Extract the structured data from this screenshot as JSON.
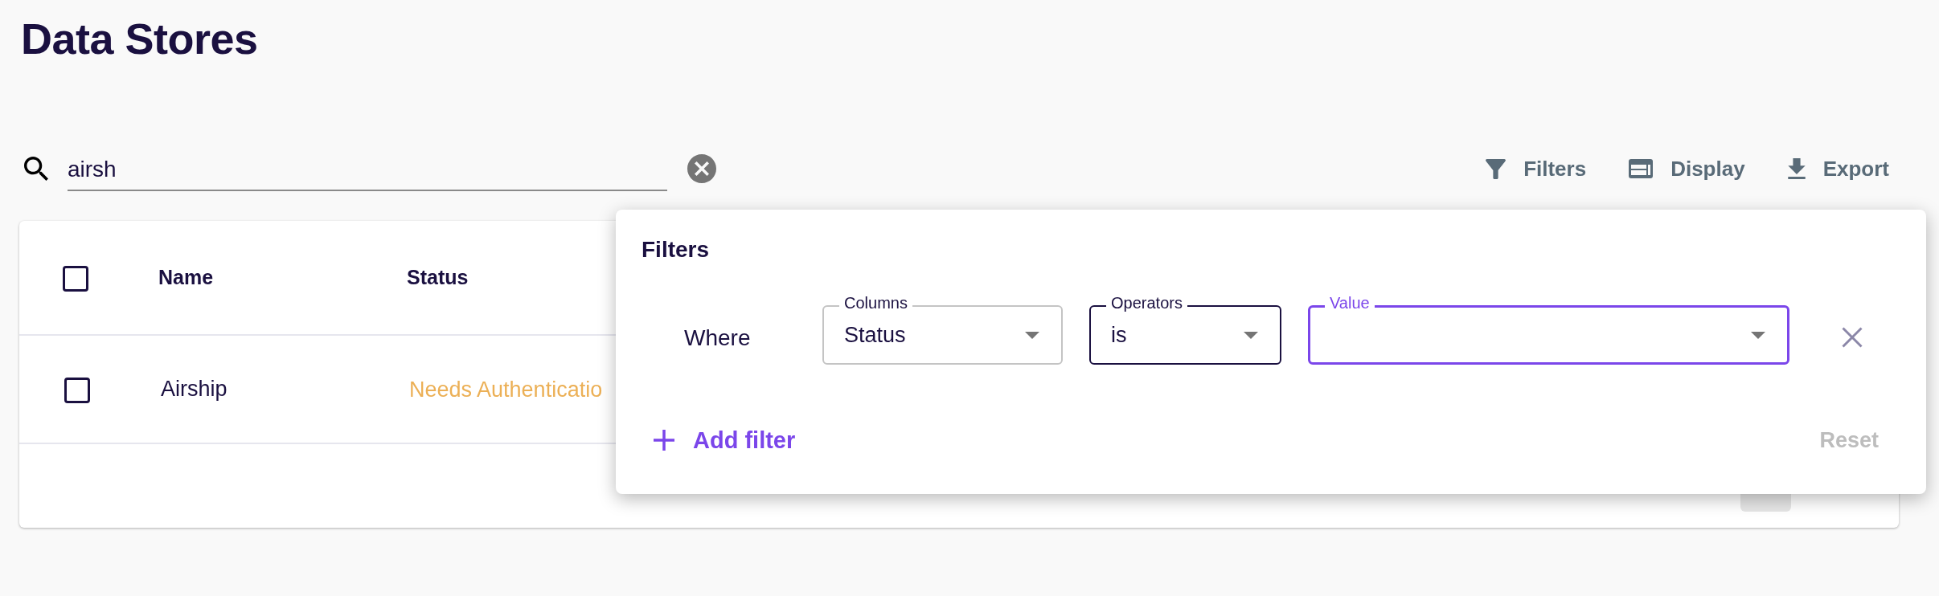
{
  "page": {
    "title": "Data Stores"
  },
  "search": {
    "value": "airsh"
  },
  "toolbar": [
    {
      "kind": "filter",
      "label": "Filters"
    },
    {
      "kind": "display",
      "label": "Display"
    },
    {
      "kind": "export",
      "label": "Export"
    }
  ],
  "table": {
    "header_checked": false,
    "columns": [
      "Name",
      "Status"
    ],
    "rows": [
      {
        "checked": false,
        "name": "Airship",
        "status": {
          "text": "Needs Authenticatio",
          "color": "#ecb056"
        }
      }
    ]
  },
  "filters_popup": {
    "title": "Filters",
    "rules": [
      {
        "conjunction": "Where",
        "fields": [
          {
            "label": "Columns",
            "value": "Status",
            "focused": false,
            "hovered": false
          },
          {
            "label": "Operators",
            "value": "is",
            "focused": false,
            "hovered": true
          },
          {
            "label": "Value",
            "focused": true,
            "hovered": false
          }
        ]
      }
    ],
    "add_button": "Add filter",
    "reset": {
      "label": "Reset",
      "disabled": true
    }
  }
}
